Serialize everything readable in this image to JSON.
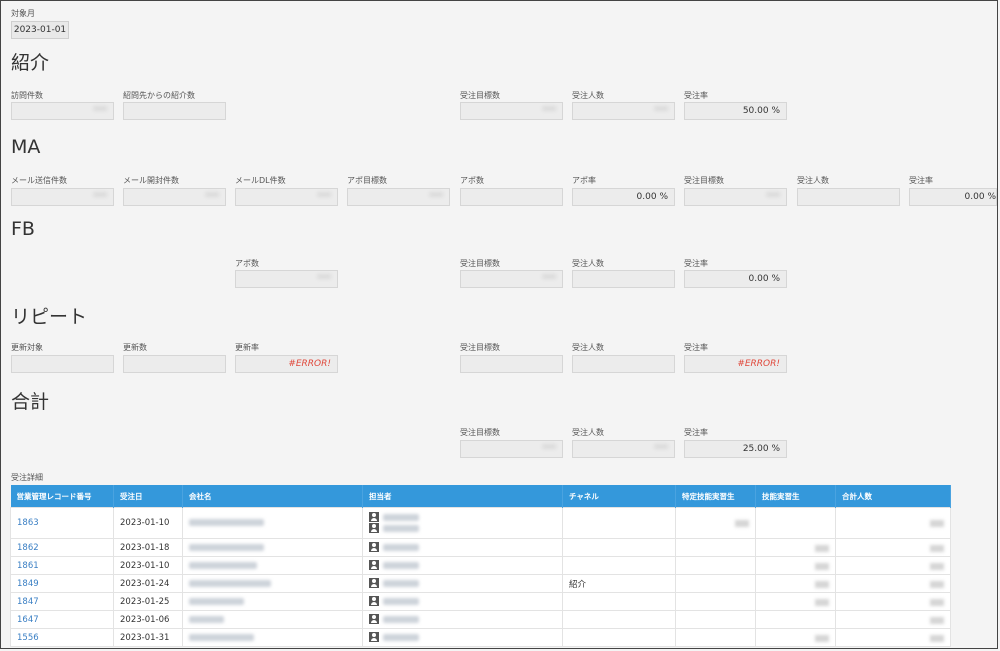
{
  "target_month": {
    "label": "対象月",
    "value": "2023-01-01"
  },
  "sections": {
    "shokai": {
      "title": "紹介",
      "fields": [
        {
          "label": "訪問件数",
          "value": "***"
        },
        {
          "label": "紹問先からの紹介数",
          "value": ""
        },
        {
          "label": "受注目標数",
          "value": "***"
        },
        {
          "label": "受注人数",
          "value": "***"
        },
        {
          "label": "受注率",
          "value": "50.00 %"
        }
      ]
    },
    "ma": {
      "title": "MA",
      "fields": [
        {
          "label": "メール送信件数",
          "value": "***"
        },
        {
          "label": "メール開封件数",
          "value": "***"
        },
        {
          "label": "メールDL件数",
          "value": "***"
        },
        {
          "label": "アポ目標数",
          "value": "***"
        },
        {
          "label": "アポ数",
          "value": ""
        },
        {
          "label": "アポ率",
          "value": "0.00 %"
        },
        {
          "label": "受注目標数",
          "value": "***"
        },
        {
          "label": "受注人数",
          "value": ""
        },
        {
          "label": "受注率",
          "value": "0.00 %"
        }
      ]
    },
    "fb": {
      "title": "FB",
      "fields": [
        {
          "label": "アポ数",
          "value": "***"
        },
        {
          "label": "受注目標数",
          "value": "***"
        },
        {
          "label": "受注人数",
          "value": ""
        },
        {
          "label": "受注率",
          "value": "0.00 %"
        }
      ]
    },
    "repeat": {
      "title": "リピート",
      "fields": [
        {
          "label": "更新対象",
          "value": ""
        },
        {
          "label": "更新数",
          "value": ""
        },
        {
          "label": "更新率",
          "value": "#ERROR!"
        },
        {
          "label": "受注目標数",
          "value": ""
        },
        {
          "label": "受注人数",
          "value": ""
        },
        {
          "label": "受注率",
          "value": "#ERROR!"
        }
      ]
    },
    "total": {
      "title": "合計",
      "fields": [
        {
          "label": "受注目標数",
          "value": "***"
        },
        {
          "label": "受注人数",
          "value": "***"
        },
        {
          "label": "受注率",
          "value": "25.00 %"
        }
      ]
    }
  },
  "detail": {
    "label": "受注詳細",
    "columns": [
      "営業管理レコード番号",
      "受注日",
      "会社名",
      "担当者",
      "チャネル",
      "特定技能実習生",
      "技能実習生",
      "合計人数"
    ],
    "rows": [
      {
        "id": "1863",
        "date": "2023-01-10",
        "channel": ""
      },
      {
        "id": "1862",
        "date": "2023-01-18",
        "channel": ""
      },
      {
        "id": "1861",
        "date": "2023-01-10",
        "channel": ""
      },
      {
        "id": "1849",
        "date": "2023-01-24",
        "channel": "紹介"
      },
      {
        "id": "1847",
        "date": "2023-01-25",
        "channel": ""
      },
      {
        "id": "1647",
        "date": "2023-01-06",
        "channel": ""
      },
      {
        "id": "1556",
        "date": "2023-01-31",
        "channel": ""
      }
    ]
  }
}
